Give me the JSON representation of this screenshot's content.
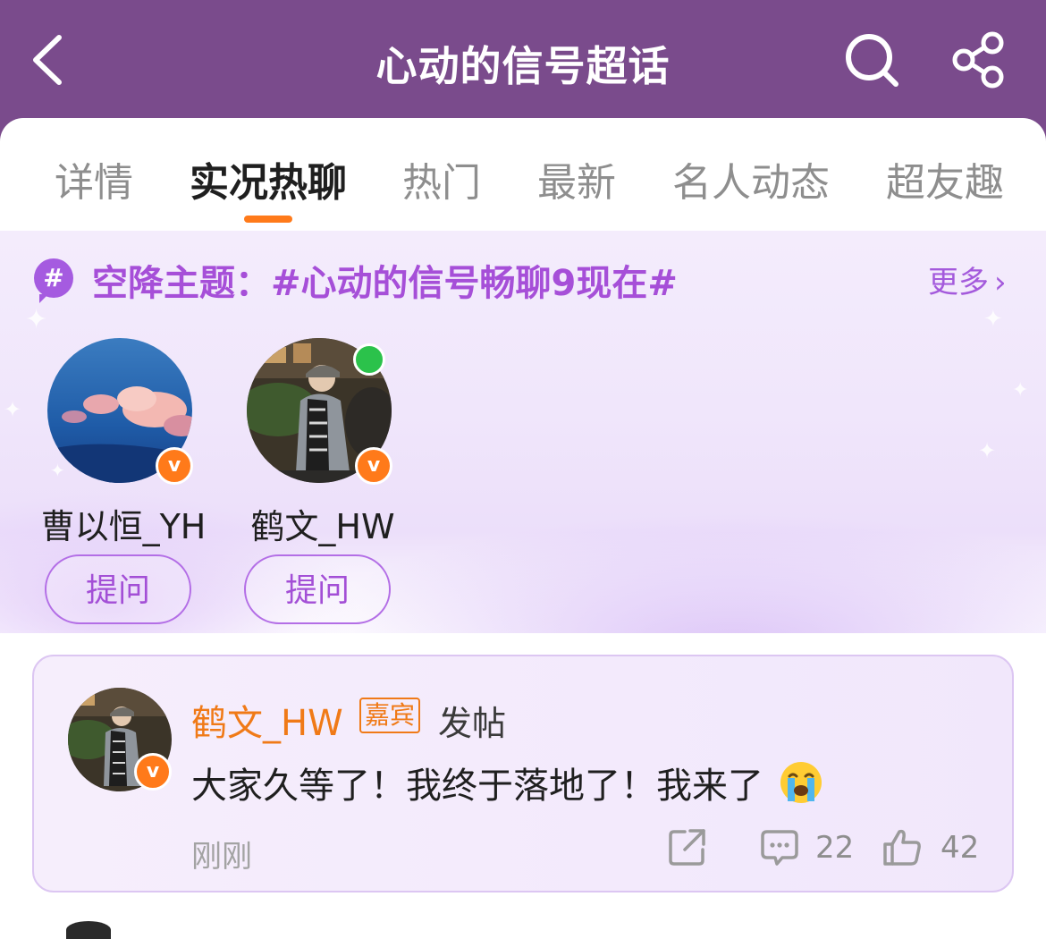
{
  "header": {
    "title": "心动的信号超话",
    "back_icon": "chevron-left-icon",
    "search_icon": "search-icon",
    "share_icon": "share-icon",
    "background_color": "#7a4b8c"
  },
  "tabs": [
    {
      "label": "详情"
    },
    {
      "label": "实况热聊",
      "active": true
    },
    {
      "label": "热门"
    },
    {
      "label": "最新"
    },
    {
      "label": "名人动态"
    },
    {
      "label": "超友趣"
    }
  ],
  "accent_color": "#ff7a1a",
  "airdrop": {
    "icon": "hashtag-icon",
    "title": "空降主题：#心动的信号畅聊9现在#",
    "more_label": "更多",
    "users": [
      {
        "name": "曹以恒_YH",
        "verified_badge": "v",
        "ask_label": "提问",
        "online": false
      },
      {
        "name": "鹤文_HW",
        "verified_badge": "v",
        "ask_label": "提问",
        "online": true
      }
    ]
  },
  "post": {
    "author": "鹤文_HW",
    "author_badge": "嘉宾",
    "action": "发帖",
    "content": "大家久等了！我终于落地了！我来了",
    "emoji": "loudly-crying-face-emoji",
    "time": "刚刚",
    "share_icon": "share-icon",
    "comment_icon": "comment-icon",
    "comments": "22",
    "like_icon": "thumbs-up-icon",
    "likes": "42",
    "verified_badge": "v"
  }
}
